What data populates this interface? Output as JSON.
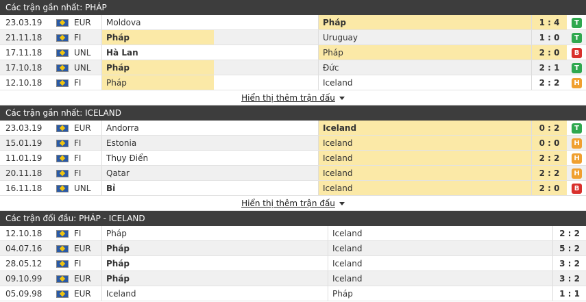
{
  "colors": {
    "win": "#2fa84f",
    "draw": "#f0a030",
    "loss": "#d9302c",
    "header": "#3d3d3d",
    "highlight": "#fbe9a7"
  },
  "sections": [
    {
      "title": "Các trận gần nhất: PHÁP",
      "show_more": "Hiển thị thêm trận đấu",
      "rows": [
        {
          "date": "23.03.19",
          "comp": "EUR",
          "home": "Moldova",
          "away": "Pháp",
          "score": "1 : 4",
          "result": "T"
        },
        {
          "date": "21.11.18",
          "comp": "FI",
          "home": "Pháp",
          "away": "Uruguay",
          "score": "1 : 0",
          "result": "T"
        },
        {
          "date": "17.11.18",
          "comp": "UNL",
          "home": "Hà Lan",
          "away": "Pháp",
          "score": "2 : 0",
          "result": "B"
        },
        {
          "date": "17.10.18",
          "comp": "UNL",
          "home": "Pháp",
          "away": "Đức",
          "score": "2 : 1",
          "result": "T"
        },
        {
          "date": "12.10.18",
          "comp": "FI",
          "home": "Pháp",
          "away": "Iceland",
          "score": "2 : 2",
          "result": "H"
        }
      ]
    },
    {
      "title": "Các trận gần nhất: ICELAND",
      "show_more": "Hiển thị thêm trận đấu",
      "rows": [
        {
          "date": "23.03.19",
          "comp": "EUR",
          "home": "Andorra",
          "away": "Iceland",
          "score": "0 : 2",
          "result": "T"
        },
        {
          "date": "15.01.19",
          "comp": "FI",
          "home": "Estonia",
          "away": "Iceland",
          "score": "0 : 0",
          "result": "H"
        },
        {
          "date": "11.01.19",
          "comp": "FI",
          "home": "Thụy Điển",
          "away": "Iceland",
          "score": "2 : 2",
          "result": "H"
        },
        {
          "date": "20.11.18",
          "comp": "FI",
          "home": "Qatar",
          "away": "Iceland",
          "score": "2 : 2",
          "result": "H"
        },
        {
          "date": "16.11.18",
          "comp": "UNL",
          "home": "Bỉ",
          "away": "Iceland",
          "score": "2 : 0",
          "result": "B"
        }
      ]
    },
    {
      "title": "Các trận đối đầu: PHÁP - ICELAND",
      "rows": [
        {
          "date": "12.10.18",
          "comp": "FI",
          "home": "Pháp",
          "away": "Iceland",
          "score": "2 : 2"
        },
        {
          "date": "04.07.16",
          "comp": "EUR",
          "home": "Pháp",
          "away": "Iceland",
          "score": "5 : 2"
        },
        {
          "date": "28.05.12",
          "comp": "FI",
          "home": "Pháp",
          "away": "Iceland",
          "score": "3 : 2"
        },
        {
          "date": "09.10.99",
          "comp": "EUR",
          "home": "Pháp",
          "away": "Iceland",
          "score": "3 : 2"
        },
        {
          "date": "05.09.98",
          "comp": "EUR",
          "home": "Iceland",
          "away": "Pháp",
          "score": "1 : 1"
        }
      ]
    }
  ]
}
